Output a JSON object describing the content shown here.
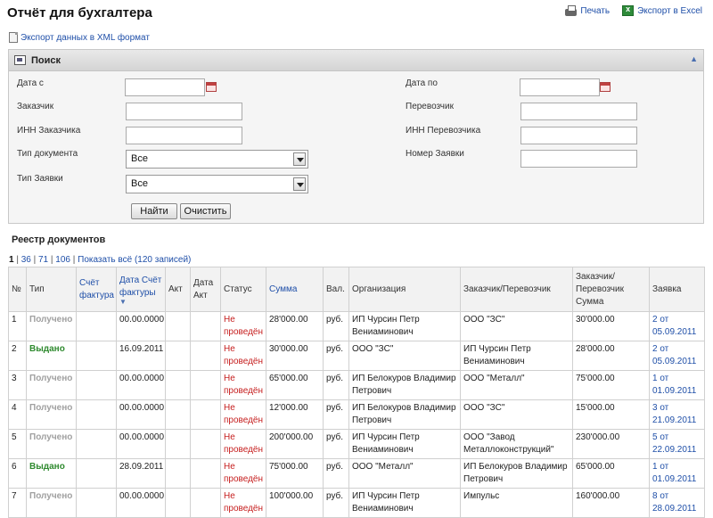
{
  "page": {
    "title": "Отчёт для бухгалтера"
  },
  "actions": {
    "print": "Печать",
    "excel": "Экспорт в Excel",
    "xml": "Экспорт данных в XML формат"
  },
  "search": {
    "title": "Поиск",
    "date_from": "Дата с",
    "date_to": "Дата по",
    "customer": "Заказчик",
    "carrier": "Перевозчик",
    "customer_inn": "ИНН Заказчика",
    "carrier_inn": "ИНН Перевозчика",
    "doc_type": "Тип документа",
    "doc_type_value": "Все",
    "request_number": "Номер Заявки",
    "request_type": "Тип Заявки",
    "request_type_value": "Все",
    "find": "Найти",
    "clear": "Очистить"
  },
  "registry": {
    "title": "Реестр документов",
    "pager": {
      "current": "1",
      "p2": "36",
      "p3": "71",
      "p4": "106",
      "show_all": "Показать всё (120 записей)"
    },
    "columns": {
      "num": "№",
      "type": "Тип",
      "invoice": "Счёт фактура",
      "invoice_date": "Дата Счёт фактуры",
      "act": "Акт",
      "act_date": "Дата Акт",
      "status": "Статус",
      "sum": "Сумма",
      "currency": "Вал.",
      "org": "Организация",
      "party": "Заказчик/Перевозчик",
      "party_sum": "Заказчик/ Перевозчик Сумма",
      "request": "Заявка"
    },
    "rows": [
      {
        "num": "1",
        "type": "Получено",
        "invoice": "",
        "inv_date": "00.00.0000",
        "act": "",
        "act_date": "",
        "status": "Не проведён",
        "sum": "28'000.00",
        "cur": "руб.",
        "org": "ИП Чурсин Петр Вениаминович",
        "party": "ООО \"ЗС\"",
        "party_sum": "30'000.00",
        "request": "2 от 05.09.2011"
      },
      {
        "num": "2",
        "type": "Выдано",
        "invoice": "",
        "inv_date": "16.09.2011",
        "act": "",
        "act_date": "",
        "status": "Не проведён",
        "sum": "30'000.00",
        "cur": "руб.",
        "org": "ООО \"ЗС\"",
        "party": "ИП Чурсин Петр Вениаминович",
        "party_sum": "28'000.00",
        "request": "2 от 05.09.2011"
      },
      {
        "num": "3",
        "type": "Получено",
        "invoice": "",
        "inv_date": "00.00.0000",
        "act": "",
        "act_date": "",
        "status": "Не проведён",
        "sum": "65'000.00",
        "cur": "руб.",
        "org": "ИП Белокуров Владимир Петрович",
        "party": "ООО \"Металл\"",
        "party_sum": "75'000.00",
        "request": "1 от 01.09.2011"
      },
      {
        "num": "4",
        "type": "Получено",
        "invoice": "",
        "inv_date": "00.00.0000",
        "act": "",
        "act_date": "",
        "status": "Не проведён",
        "sum": "12'000.00",
        "cur": "руб.",
        "org": "ИП Белокуров Владимир Петрович",
        "party": "ООО \"ЗС\"",
        "party_sum": "15'000.00",
        "request": "3 от 21.09.2011"
      },
      {
        "num": "5",
        "type": "Получено",
        "invoice": "",
        "inv_date": "00.00.0000",
        "act": "",
        "act_date": "",
        "status": "Не проведён",
        "sum": "200'000.00",
        "cur": "руб.",
        "org": "ИП Чурсин Петр Вениаминович",
        "party": "ООО \"Завод Металлоконструкций\"",
        "party_sum": "230'000.00",
        "request": "5 от 22.09.2011"
      },
      {
        "num": "6",
        "type": "Выдано",
        "invoice": "",
        "inv_date": "28.09.2011",
        "act": "",
        "act_date": "",
        "status": "Не проведён",
        "sum": "75'000.00",
        "cur": "руб.",
        "org": "ООО \"Металл\"",
        "party": "ИП Белокуров Владимир Петрович",
        "party_sum": "65'000.00",
        "request": "1 от 01.09.2011"
      },
      {
        "num": "7",
        "type": "Получено",
        "invoice": "",
        "inv_date": "00.00.0000",
        "act": "",
        "act_date": "",
        "status": "Не проведён",
        "sum": "100'000.00",
        "cur": "руб.",
        "org": "ИП Чурсин Петр Вениаминович",
        "party": "Импульс",
        "party_sum": "160'000.00",
        "request": "8 от 28.09.2011"
      }
    ]
  }
}
